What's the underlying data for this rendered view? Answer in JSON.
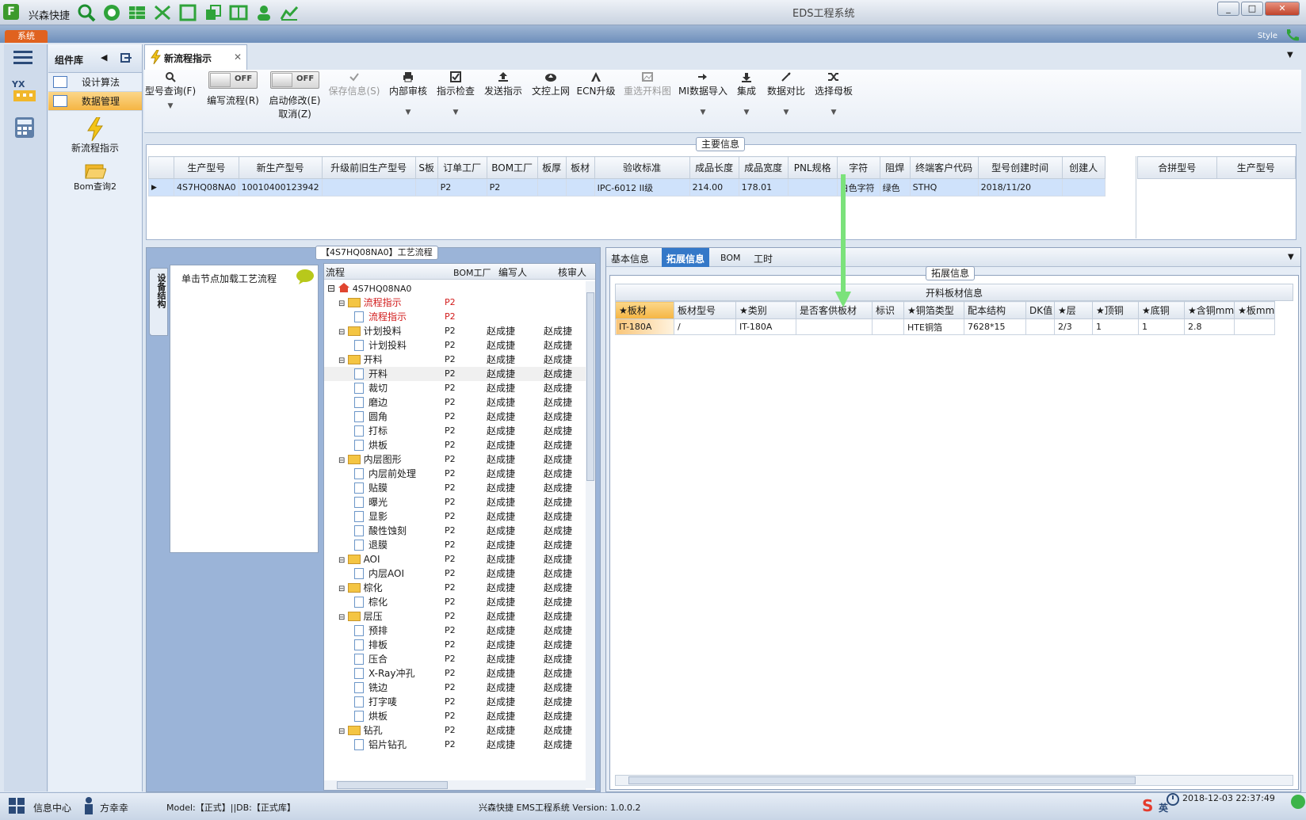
{
  "app": {
    "name": "兴森快捷",
    "window_title": "EDS工程系统",
    "system_tab": "系统",
    "style_label": "Style"
  },
  "sidebar": {
    "header": "组件库",
    "items": [
      {
        "label": "设计算法"
      },
      {
        "label": "数据管理"
      }
    ],
    "big_items": [
      {
        "label": "新流程指示"
      },
      {
        "label": "Bom查询2"
      }
    ]
  },
  "tab": {
    "label": "新流程指示"
  },
  "toolbar": {
    "query": "型号查询(F)",
    "edit_flow": "编写流程(R)",
    "start_modify": "启动修改(E)",
    "cancel": "取消(Z)",
    "toggle_off": "OFF",
    "save": "保存信息(S)",
    "internal_review": "内部审核",
    "check": "指示检查",
    "send": "发送指示",
    "upload": "文控上网",
    "ecn": "ECN升级",
    "reselect": "重选开料图",
    "mi_import": "MI数据导入",
    "integrate": "集成",
    "compare": "数据对比",
    "select_mother": "选择母板"
  },
  "main_info": {
    "title": "主要信息",
    "columns": [
      "生产型号",
      "新生产型号",
      "升级前旧生产型号",
      "S板",
      "订单工厂",
      "BOM工厂",
      "板厚",
      "板材",
      "验收标准",
      "成品长度",
      "成品宽度",
      "PNL规格",
      "字符",
      "阻焊",
      "终端客户代码",
      "型号创建时间",
      "创建人"
    ],
    "row": [
      "4S7HQ08NA0",
      "10010400123942",
      "",
      "",
      "P2",
      "P2",
      "",
      "",
      "IPC-6012 II级",
      "214.00",
      "178.01",
      "",
      "白色字符",
      "绿色",
      "STHQ",
      "2018/11/20",
      ""
    ],
    "right_columns": [
      "合拼型号",
      "生产型号"
    ]
  },
  "flow": {
    "title": "【4S7HQ08NA0】工艺流程",
    "side_tab": "设备结构",
    "hint": "单击节点加载工艺流程",
    "columns": [
      "流程",
      "BOM工厂",
      "编写人",
      "核审人"
    ],
    "root": "4S7HQ08NA0",
    "rows": [
      {
        "level": 1,
        "type": "folder",
        "name": "流程指示",
        "bom": "P2",
        "writer": "",
        "reviewer": "",
        "red": true
      },
      {
        "level": 2,
        "type": "doc",
        "name": "流程指示",
        "bom": "P2",
        "writer": "",
        "reviewer": "",
        "red": true
      },
      {
        "level": 1,
        "type": "folder",
        "name": "计划投料",
        "bom": "P2",
        "writer": "赵成捷",
        "reviewer": "赵成捷"
      },
      {
        "level": 2,
        "type": "doc",
        "name": "计划投料",
        "bom": "P2",
        "writer": "赵成捷",
        "reviewer": "赵成捷"
      },
      {
        "level": 1,
        "type": "folder",
        "name": "开料",
        "bom": "P2",
        "writer": "赵成捷",
        "reviewer": "赵成捷"
      },
      {
        "level": 2,
        "type": "doc",
        "name": "开料",
        "bom": "P2",
        "writer": "赵成捷",
        "reviewer": "赵成捷"
      },
      {
        "level": 2,
        "type": "doc",
        "name": "裁切",
        "bom": "P2",
        "writer": "赵成捷",
        "reviewer": "赵成捷"
      },
      {
        "level": 2,
        "type": "doc",
        "name": "磨边",
        "bom": "P2",
        "writer": "赵成捷",
        "reviewer": "赵成捷"
      },
      {
        "level": 2,
        "type": "doc",
        "name": "圆角",
        "bom": "P2",
        "writer": "赵成捷",
        "reviewer": "赵成捷"
      },
      {
        "level": 2,
        "type": "doc",
        "name": "打标",
        "bom": "P2",
        "writer": "赵成捷",
        "reviewer": "赵成捷"
      },
      {
        "level": 2,
        "type": "doc",
        "name": "烘板",
        "bom": "P2",
        "writer": "赵成捷",
        "reviewer": "赵成捷"
      },
      {
        "level": 1,
        "type": "folder",
        "name": "内层图形",
        "bom": "P2",
        "writer": "赵成捷",
        "reviewer": "赵成捷"
      },
      {
        "level": 2,
        "type": "doc",
        "name": "内层前处理",
        "bom": "P2",
        "writer": "赵成捷",
        "reviewer": "赵成捷"
      },
      {
        "level": 2,
        "type": "doc",
        "name": "贴膜",
        "bom": "P2",
        "writer": "赵成捷",
        "reviewer": "赵成捷"
      },
      {
        "level": 2,
        "type": "doc",
        "name": "曝光",
        "bom": "P2",
        "writer": "赵成捷",
        "reviewer": "赵成捷"
      },
      {
        "level": 2,
        "type": "doc",
        "name": "显影",
        "bom": "P2",
        "writer": "赵成捷",
        "reviewer": "赵成捷"
      },
      {
        "level": 2,
        "type": "doc",
        "name": "酸性蚀刻",
        "bom": "P2",
        "writer": "赵成捷",
        "reviewer": "赵成捷"
      },
      {
        "level": 2,
        "type": "doc",
        "name": "退膜",
        "bom": "P2",
        "writer": "赵成捷",
        "reviewer": "赵成捷"
      },
      {
        "level": 1,
        "type": "folder",
        "name": "AOI",
        "bom": "P2",
        "writer": "赵成捷",
        "reviewer": "赵成捷"
      },
      {
        "level": 2,
        "type": "doc",
        "name": "内层AOI",
        "bom": "P2",
        "writer": "赵成捷",
        "reviewer": "赵成捷"
      },
      {
        "level": 1,
        "type": "folder",
        "name": "棕化",
        "bom": "P2",
        "writer": "赵成捷",
        "reviewer": "赵成捷"
      },
      {
        "level": 2,
        "type": "doc",
        "name": "棕化",
        "bom": "P2",
        "writer": "赵成捷",
        "reviewer": "赵成捷"
      },
      {
        "level": 1,
        "type": "folder",
        "name": "层压",
        "bom": "P2",
        "writer": "赵成捷",
        "reviewer": "赵成捷"
      },
      {
        "level": 2,
        "type": "doc",
        "name": "预排",
        "bom": "P2",
        "writer": "赵成捷",
        "reviewer": "赵成捷"
      },
      {
        "level": 2,
        "type": "doc",
        "name": "排板",
        "bom": "P2",
        "writer": "赵成捷",
        "reviewer": "赵成捷"
      },
      {
        "level": 2,
        "type": "doc",
        "name": "压合",
        "bom": "P2",
        "writer": "赵成捷",
        "reviewer": "赵成捷"
      },
      {
        "level": 2,
        "type": "doc",
        "name": "X-Ray冲孔",
        "bom": "P2",
        "writer": "赵成捷",
        "reviewer": "赵成捷"
      },
      {
        "level": 2,
        "type": "doc",
        "name": "铣边",
        "bom": "P2",
        "writer": "赵成捷",
        "reviewer": "赵成捷"
      },
      {
        "level": 2,
        "type": "doc",
        "name": "打字唛",
        "bom": "P2",
        "writer": "赵成捷",
        "reviewer": "赵成捷"
      },
      {
        "level": 2,
        "type": "doc",
        "name": "烘板",
        "bom": "P2",
        "writer": "赵成捷",
        "reviewer": "赵成捷"
      },
      {
        "level": 1,
        "type": "folder",
        "name": "钻孔",
        "bom": "P2",
        "writer": "赵成捷",
        "reviewer": "赵成捷"
      },
      {
        "level": 2,
        "type": "doc",
        "name": "铝片钻孔",
        "bom": "P2",
        "writer": "赵成捷",
        "reviewer": "赵成捷"
      }
    ]
  },
  "detail": {
    "tabs": [
      "基本信息",
      "拓展信息",
      "BOM",
      "工时"
    ],
    "active_tab": "拓展信息",
    "section_title": "拓展信息",
    "table_title": "开料板材信息",
    "columns": [
      "★板材",
      "板材型号",
      "★类别",
      "是否客供板材",
      "标识",
      "★铜箔类型",
      "配本结构",
      "DK值",
      "★层",
      "★顶铜",
      "★底铜",
      "★含铜mm",
      "★板mm"
    ],
    "row": [
      "IT-180A",
      "/",
      "IT-180A",
      "",
      "",
      "HTE铜箔",
      "7628*15",
      "",
      "2/3",
      "1",
      "1",
      "2.8",
      ""
    ]
  },
  "status": {
    "info_center": "信息中心",
    "user": "方幸幸",
    "model_db": "Model:【正式】||DB:【正式库】",
    "version": "兴森快捷 EMS工程系统 Version: 1.0.0.2",
    "datetime": "2018-12-03 22:37:49",
    "ime": "英"
  },
  "colors": {
    "accent": "#3478c8",
    "selection": "#cfe2fb",
    "highlight": "#f9c67a",
    "arrow": "#7be27b"
  }
}
